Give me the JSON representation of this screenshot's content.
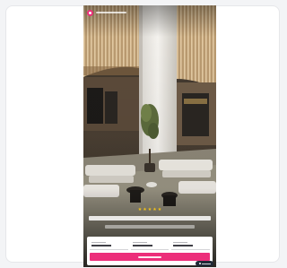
{
  "colors": {
    "accent": "#ec2e7a",
    "stars": "#f5c518"
  },
  "hero": {
    "rating_stars": 5,
    "star_glyph": "★"
  }
}
